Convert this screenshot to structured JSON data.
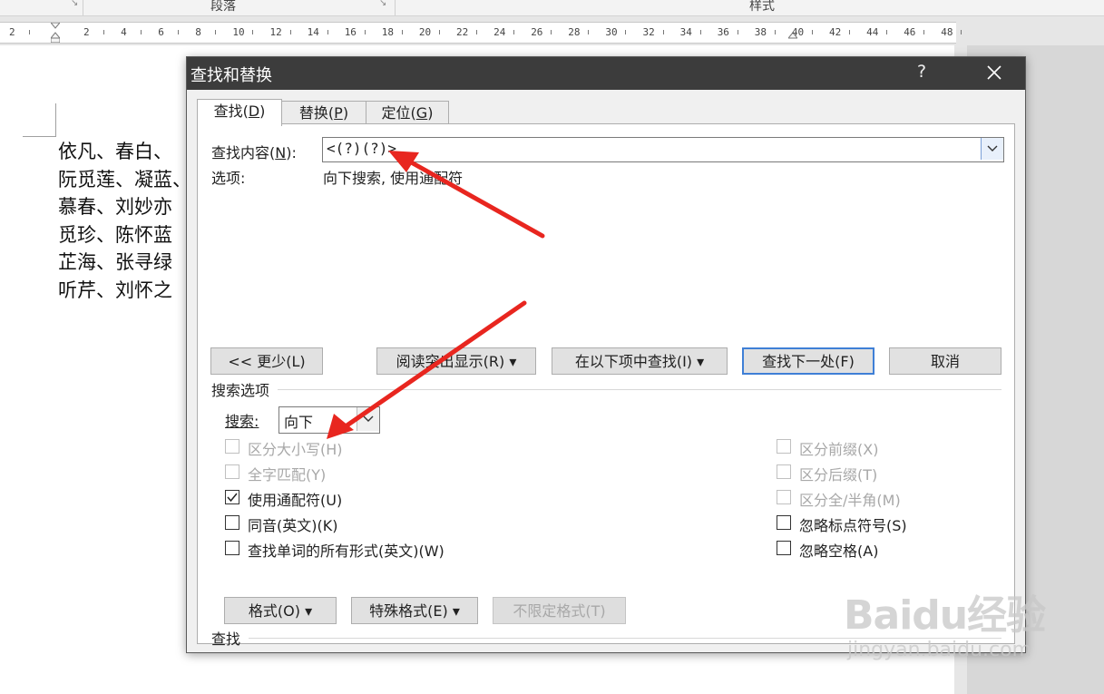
{
  "ribbon": {
    "group_paragraph": "段落",
    "group_styles": "样式"
  },
  "ruler": {
    "numbers": [
      "2",
      "2",
      "4",
      "6",
      "8",
      "10",
      "12",
      "14",
      "16",
      "18",
      "20",
      "22",
      "24",
      "26",
      "28",
      "30",
      "32",
      "34",
      "36",
      "38",
      "40",
      "42",
      "44",
      "46",
      "48"
    ]
  },
  "document": {
    "lines": [
      "依凡、春白、",
      "阮觅莲、凝蓝、",
      "慕春、刘妙亦",
      "觅珍、陈怀蓝",
      "芷海、张寻绿",
      "听芹、刘怀之"
    ]
  },
  "dialog": {
    "title": "查找和替换",
    "help": "?",
    "tabs": [
      {
        "label": "查找",
        "key": "D"
      },
      {
        "label": "替换",
        "key": "P"
      },
      {
        "label": "定位",
        "key": "G"
      }
    ],
    "find_label": "查找内容",
    "find_key": "N",
    "find_value": "<(?)(?)>",
    "options_label": "选项:",
    "options_value": "向下搜索, 使用通配符",
    "buttons": {
      "less": "<< 更少(L)",
      "reading_highlight": "阅读突出显示(R)",
      "find_in": "在以下项中查找(I)",
      "find_next": "查找下一处(F)",
      "cancel": "取消"
    },
    "search_options_title": "搜索选项",
    "search_label": "搜索:",
    "search_value": "向下",
    "left_options": [
      {
        "label": "区分大小写(H)",
        "checked": false,
        "disabled": true
      },
      {
        "label": "全字匹配(Y)",
        "checked": false,
        "disabled": true
      },
      {
        "label": "使用通配符(U)",
        "checked": true,
        "disabled": false
      },
      {
        "label": "同音(英文)(K)",
        "checked": false,
        "disabled": false
      },
      {
        "label": "查找单词的所有形式(英文)(W)",
        "checked": false,
        "disabled": false
      }
    ],
    "right_options": [
      {
        "label": "区分前缀(X)",
        "checked": false,
        "disabled": true
      },
      {
        "label": "区分后缀(T)",
        "checked": false,
        "disabled": true
      },
      {
        "label": "区分全/半角(M)",
        "checked": false,
        "disabled": true
      },
      {
        "label": "忽略标点符号(S)",
        "checked": false,
        "disabled": false
      },
      {
        "label": "忽略空格(A)",
        "checked": false,
        "disabled": false
      }
    ],
    "find_section_title": "查找",
    "bottom_buttons": {
      "format": "格式(O)",
      "special": "特殊格式(E)",
      "no_format": "不限定格式(T)"
    }
  },
  "watermark": {
    "logo": "Baidu经验",
    "url": "jingyan.baidu.com"
  },
  "colors": {
    "titlebar": "#3c3c3c",
    "arrow": "#e8261f",
    "default_button": "#3f7fd6"
  }
}
